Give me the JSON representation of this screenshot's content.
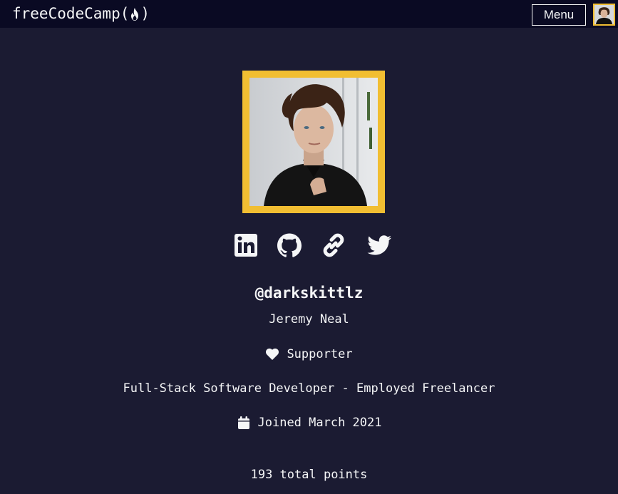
{
  "navbar": {
    "logo_text": "freeCodeCamp",
    "logo_open_paren": "(",
    "logo_close_paren": ")",
    "menu_label": "Menu"
  },
  "profile": {
    "username": "@darkskittlz",
    "name": "Jeremy Neal",
    "supporter_label": "Supporter",
    "bio": "Full-Stack Software Developer - Employed Freelancer",
    "joined": "Joined March 2021",
    "points": "193 total points"
  },
  "social_icons": [
    "linkedin-icon",
    "github-icon",
    "link-icon",
    "twitter-icon"
  ],
  "colors": {
    "background": "#1b1b32",
    "navbar": "#0a0a23",
    "accent_yellow": "#f1be32",
    "text": "#f5f6f7"
  }
}
